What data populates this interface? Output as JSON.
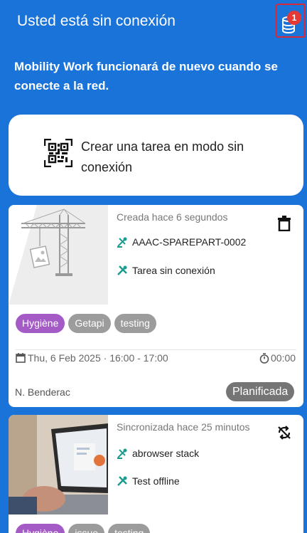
{
  "header": {
    "title": "Usted está sin conexión",
    "pending_count": "1"
  },
  "offline_message": "Mobility Work funcionará de nuevo cuando se conecte a la red.",
  "create_card": {
    "label": "Crear una tarea en modo sin conexión"
  },
  "tasks": [
    {
      "meta": "Creada hace 6 segundos",
      "equipment": "AAAC-SPAREPART-0002",
      "title": "Tarea sin conexión",
      "tags": [
        "Hygiène",
        "Getapi",
        "testing"
      ],
      "date": "Thu, 6 Feb 2025",
      "time": "16:00 - 17:00",
      "duration": "00:00",
      "owner": "N. Benderac",
      "status": "Planificada",
      "action_icon": "trash-icon"
    },
    {
      "meta": "Sincronizada hace 25 minutos",
      "equipment": "abrowser stack",
      "title": "Test offline",
      "tags": [
        "Hygiène",
        "issue",
        "testing"
      ],
      "action_icon": "sync-disabled-icon"
    }
  ],
  "colors": {
    "header_bg": "#1a73d9",
    "tag_purple": "#a55bc5",
    "tag_gray": "#9c9c9c",
    "status_gray": "#757575",
    "icon_teal": "#1a9d8f",
    "badge_red": "#e53935"
  }
}
